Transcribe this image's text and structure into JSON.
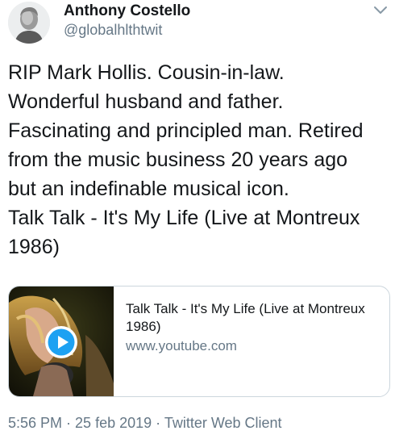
{
  "author": {
    "name": "Anthony Costello",
    "handle": "@globalhlthtwit",
    "avatar_icon": "profile-photo"
  },
  "menu_icon": "chevron-down-icon",
  "tweet": {
    "text": "RIP Mark Hollis. Cousin-in-law.\nWonderful husband and father.\nFascinating and principled man. Retired\nfrom the music business 20 years ago\nbut an indefinable musical icon.\nTalk Talk - It's My Life (Live at Montreux\n1986)"
  },
  "link_card": {
    "title": "Talk Talk - It's My Life (Live at Montreux 1986)",
    "domain": "www.youtube.com",
    "play_icon": "play-icon",
    "accent_color": "#1da1f2"
  },
  "meta": {
    "time": "5:56 PM",
    "separator": " · ",
    "date": "25 feb 2019",
    "client": "Twitter Web Client"
  },
  "colors": {
    "text": "#14171a",
    "secondary": "#657786",
    "border": "#ccd6dd"
  }
}
